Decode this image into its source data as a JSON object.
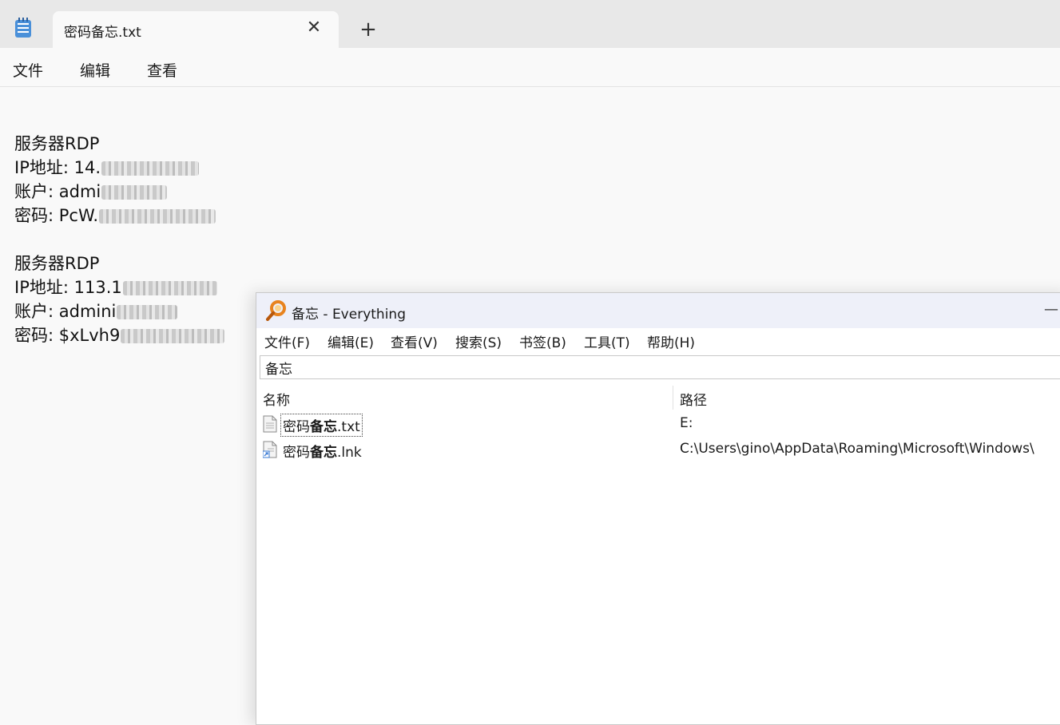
{
  "notepad": {
    "tab_title": "密码备忘.txt",
    "close_glyph": "✕",
    "new_tab_glyph": "+",
    "menu": [
      "文件",
      "编辑",
      "查看"
    ],
    "content": [
      {
        "heading": "服务器RDP",
        "ip_label": "IP地址: 14.",
        "account_label": "账户: admi",
        "password_label": "密码: PcW."
      },
      {
        "heading": "服务器RDP",
        "ip_label": "IP地址: 113.1",
        "account_label": "账户: admini",
        "password_label": "密码: $xLvh9"
      }
    ]
  },
  "everything": {
    "title": "备忘 - Everything",
    "minimize_glyph": "—",
    "menu": [
      "文件(F)",
      "编辑(E)",
      "查看(V)",
      "搜索(S)",
      "书签(B)",
      "工具(T)",
      "帮助(H)"
    ],
    "search_value": "备忘",
    "columns": {
      "name": "名称",
      "path": "路径"
    },
    "results": [
      {
        "name_prefix": "密码",
        "name_match": "备忘",
        "name_suffix": ".txt",
        "path": "E:",
        "icon": "text-file-icon"
      },
      {
        "name_prefix": "密码",
        "name_match": "备忘",
        "name_suffix": ".lnk",
        "path": "C:\\Users\\gino\\AppData\\Roaming\\Microsoft\\Windows\\",
        "icon": "shortcut-file-icon"
      }
    ]
  },
  "colors": {
    "tabbar_bg": "#e8e8e8",
    "editor_bg": "#f9f9f9",
    "everything_titlebar": "#eef0f9",
    "logo_orange": "#e8831e"
  }
}
